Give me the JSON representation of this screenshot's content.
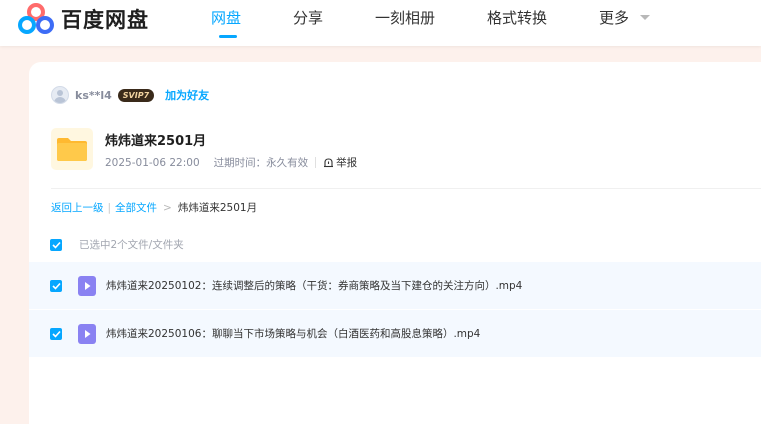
{
  "brand": {
    "name": "百度网盘"
  },
  "nav": {
    "items": [
      {
        "label": "网盘"
      },
      {
        "label": "分享"
      },
      {
        "label": "一刻相册"
      },
      {
        "label": "格式转换"
      },
      {
        "label": "更多"
      }
    ]
  },
  "colors": {
    "accent": "#06a7ff",
    "folder": "#ffc94a",
    "video": "#8a82f2"
  },
  "sharer": {
    "username": "ks**l4",
    "vip_badge": "SVIP7",
    "add_friend": "加为好友"
  },
  "share": {
    "title": "炜炜道来2501月",
    "date": "2025-01-06 22:00",
    "expiry_label": "过期时间：",
    "expiry_value": "永久有效",
    "report": "举报"
  },
  "breadcrumb": {
    "back": "返回上一级",
    "all_files": "全部文件",
    "current": "炜炜道来2501月"
  },
  "selection": {
    "text": "已选中2个文件/文件夹",
    "all_checked": true
  },
  "files": [
    {
      "name": "炜炜道来20250102：连续调整后的策略（干货：券商策略及当下建仓的关注方向）.mp4",
      "checked": true,
      "icon": "video-file-icon"
    },
    {
      "name": "炜炜道来20250106：聊聊当下市场策略与机会（白酒医药和高股息策略）.mp4",
      "checked": true,
      "icon": "video-file-icon"
    }
  ]
}
